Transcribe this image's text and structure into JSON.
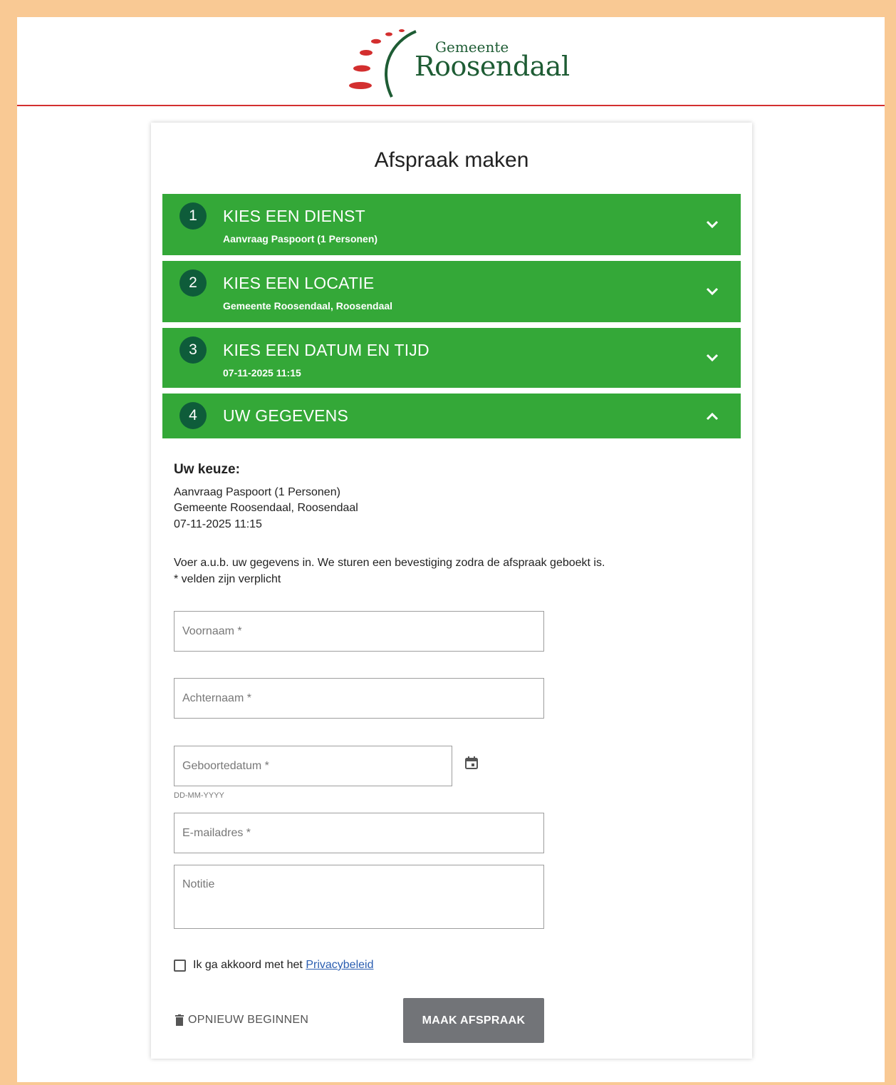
{
  "brand": {
    "small": "Gemeente",
    "big": "Roosendaal",
    "accent": "#d32f2f",
    "green": "#1e5c34"
  },
  "page_title": "Afspraak maken",
  "steps": [
    {
      "num": "1",
      "title": "KIES EEN DIENST",
      "sub": "Aanvraag Paspoort (1 Personen)",
      "state": "collapsed"
    },
    {
      "num": "2",
      "title": "KIES EEN LOCATIE",
      "sub": "Gemeente Roosendaal, Roosendaal",
      "state": "collapsed"
    },
    {
      "num": "3",
      "title": "KIES EEN DATUM EN TIJD",
      "sub": "07-11-2025 11:15",
      "state": "collapsed"
    },
    {
      "num": "4",
      "title": "UW GEGEVENS",
      "sub": "",
      "state": "expanded"
    }
  ],
  "step_color": "#34a838",
  "keuze": {
    "heading": "Uw keuze:",
    "lines": [
      "Aanvraag Paspoort (1 Personen)",
      "Gemeente Roosendaal, Roosendaal",
      "07-11-2025 11:15"
    ]
  },
  "info": {
    "line1": "Voer a.u.b. uw gegevens in. We sturen een bevestiging zodra de afspraak geboekt is.",
    "line2": "* velden zijn verplicht"
  },
  "form": {
    "voornaam_placeholder": "Voornaam *",
    "achternaam_placeholder": "Achternaam *",
    "geboortedatum_placeholder": "Geboortedatum *",
    "geboortedatum_hint": "DD-MM-YYYY",
    "email_placeholder": "E-mailadres *",
    "notitie_placeholder": "Notitie"
  },
  "agree": {
    "text": "Ik ga akkoord met het ",
    "link": "Privacybeleid",
    "checked": false
  },
  "actions": {
    "restart": "OPNIEUW BEGINNEN",
    "submit": "MAAK AFSPRAAK"
  }
}
